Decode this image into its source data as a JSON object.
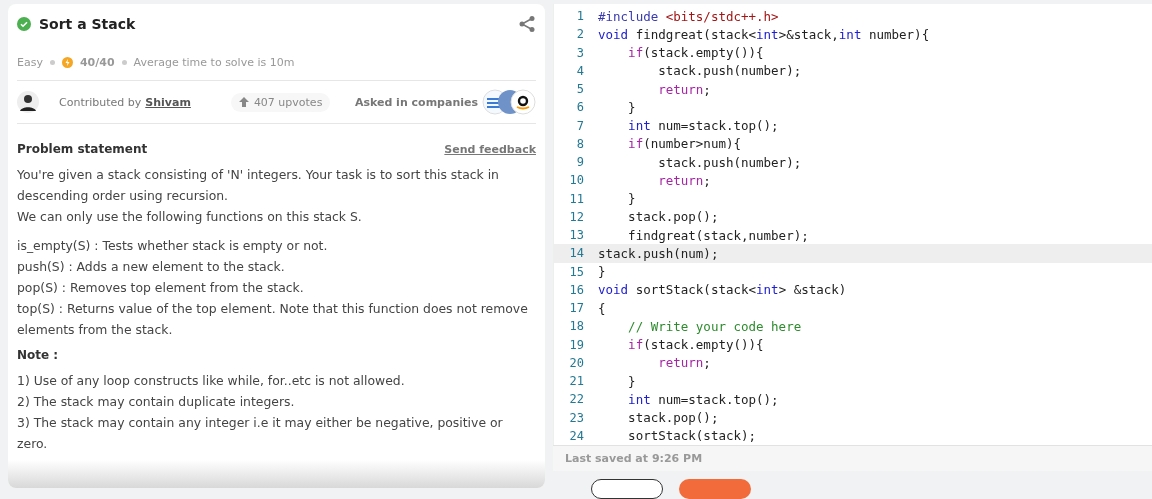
{
  "problem": {
    "title": "Sort a Stack",
    "solved": true,
    "difficulty": "Easy",
    "score": "40/40",
    "avg_time": "Average time to solve is 10m",
    "contributed_label": "Contributed by",
    "contributor": "Shivam",
    "upvotes": "407 upvotes",
    "companies_label": "Asked in companies"
  },
  "statement": {
    "heading": "Problem statement",
    "feedback": "Send feedback",
    "paragraphs": [
      [
        "You're given a stack consisting of 'N' integers. Your task is to sort this stack in descending order using recursion.",
        "We can only use the following functions on this stack S."
      ],
      [
        "is_empty(S) : Tests whether stack is empty or not.",
        "push(S) : Adds a new element to the stack.",
        "pop(S) : Removes top element from the stack.",
        "top(S) : Returns value of the top element. Note that this function does not remove elements from the stack."
      ]
    ],
    "note_heading": "Note :",
    "notes": [
      "1) Use of any loop constructs like while, for..etc is not allowed.",
      "2) The stack may contain duplicate integers.",
      "3) The stack may contain any integer i.e it may either be negative, positive or zero."
    ]
  },
  "editor": {
    "lines": [
      {
        "no": "1",
        "highlighted": false,
        "tokens": [
          {
            "kind": "pre",
            "t": "#include "
          },
          {
            "kind": "str",
            "t": "<bits/stdc++.h>"
          }
        ]
      },
      {
        "no": "2",
        "highlighted": false,
        "tokens": [
          {
            "kind": "type",
            "t": "void"
          },
          {
            "kind": "plain",
            "t": " findgreat(stack<"
          },
          {
            "kind": "type",
            "t": "int"
          },
          {
            "kind": "plain",
            "t": ">&stack,"
          },
          {
            "kind": "type",
            "t": "int"
          },
          {
            "kind": "plain",
            "t": " number){"
          }
        ]
      },
      {
        "no": "3",
        "highlighted": false,
        "tokens": [
          {
            "kind": "ctrl",
            "t": "    if"
          },
          {
            "kind": "plain",
            "t": "(stack.empty()){"
          }
        ]
      },
      {
        "no": "4",
        "highlighted": false,
        "tokens": [
          {
            "kind": "plain",
            "t": "        stack.push(number);"
          }
        ]
      },
      {
        "no": "5",
        "highlighted": false,
        "tokens": [
          {
            "kind": "ctrl",
            "t": "        return"
          },
          {
            "kind": "plain",
            "t": ";"
          }
        ]
      },
      {
        "no": "6",
        "highlighted": false,
        "tokens": [
          {
            "kind": "plain",
            "t": "    }"
          }
        ]
      },
      {
        "no": "7",
        "highlighted": false,
        "tokens": [
          {
            "kind": "type",
            "t": "    int"
          },
          {
            "kind": "plain",
            "t": " num=stack.top();"
          }
        ]
      },
      {
        "no": "8",
        "highlighted": false,
        "tokens": [
          {
            "kind": "ctrl",
            "t": "    if"
          },
          {
            "kind": "plain",
            "t": "(number>num){"
          }
        ]
      },
      {
        "no": "9",
        "highlighted": false,
        "tokens": [
          {
            "kind": "plain",
            "t": "        stack.push(number);"
          }
        ]
      },
      {
        "no": "10",
        "highlighted": false,
        "tokens": [
          {
            "kind": "ctrl",
            "t": "        return"
          },
          {
            "kind": "plain",
            "t": ";"
          }
        ]
      },
      {
        "no": "11",
        "highlighted": false,
        "tokens": [
          {
            "kind": "plain",
            "t": "    }"
          }
        ]
      },
      {
        "no": "12",
        "highlighted": false,
        "tokens": [
          {
            "kind": "plain",
            "t": "    stack.pop();"
          }
        ]
      },
      {
        "no": "13",
        "highlighted": false,
        "tokens": [
          {
            "kind": "plain",
            "t": "    findgreat(stack,number);"
          }
        ]
      },
      {
        "no": "14",
        "highlighted": true,
        "tokens": [
          {
            "kind": "plain",
            "t": "stack.push(num);"
          }
        ]
      },
      {
        "no": "15",
        "highlighted": false,
        "tokens": [
          {
            "kind": "plain",
            "t": "}"
          }
        ]
      },
      {
        "no": "16",
        "highlighted": false,
        "tokens": [
          {
            "kind": "type",
            "t": "void"
          },
          {
            "kind": "plain",
            "t": " sortStack(stack<"
          },
          {
            "kind": "type",
            "t": "int"
          },
          {
            "kind": "plain",
            "t": "> &stack)"
          }
        ]
      },
      {
        "no": "17",
        "highlighted": false,
        "tokens": [
          {
            "kind": "plain",
            "t": "{"
          }
        ]
      },
      {
        "no": "18",
        "highlighted": false,
        "tokens": [
          {
            "kind": "cm",
            "t": "    // Write your code here"
          }
        ]
      },
      {
        "no": "19",
        "highlighted": false,
        "tokens": [
          {
            "kind": "ctrl",
            "t": "    if"
          },
          {
            "kind": "plain",
            "t": "(stack.empty()){"
          }
        ]
      },
      {
        "no": "20",
        "highlighted": false,
        "tokens": [
          {
            "kind": "ctrl",
            "t": "        return"
          },
          {
            "kind": "plain",
            "t": ";"
          }
        ]
      },
      {
        "no": "21",
        "highlighted": false,
        "tokens": [
          {
            "kind": "plain",
            "t": "    }"
          }
        ]
      },
      {
        "no": "22",
        "highlighted": false,
        "tokens": [
          {
            "kind": "type",
            "t": "    int"
          },
          {
            "kind": "plain",
            "t": " num=stack.top();"
          }
        ]
      },
      {
        "no": "23",
        "highlighted": false,
        "tokens": [
          {
            "kind": "plain",
            "t": "    stack.pop();"
          }
        ]
      },
      {
        "no": "24",
        "highlighted": false,
        "tokens": [
          {
            "kind": "plain",
            "t": "    sortStack(stack);"
          }
        ]
      }
    ],
    "status": "Last saved at 9:26 PM"
  }
}
